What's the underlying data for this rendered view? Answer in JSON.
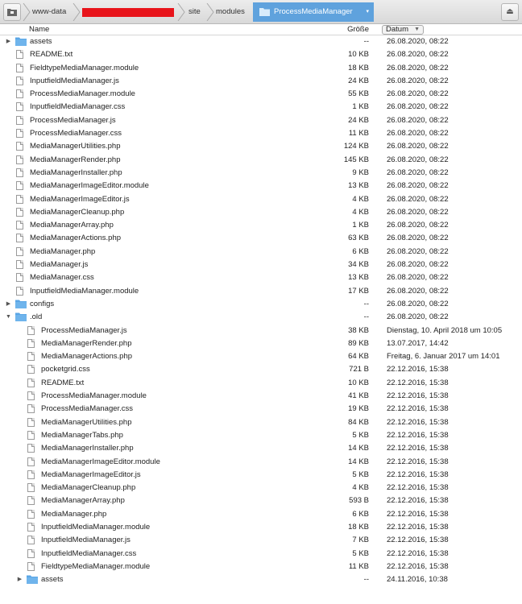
{
  "pathbar": {
    "crumbs": [
      "www-data",
      "site",
      "modules"
    ],
    "active": "ProcessMediaManager"
  },
  "columns": {
    "name": "Name",
    "size": "Größe",
    "date": "Datum"
  },
  "colors": {
    "folder": "#5aa6e6",
    "active_crumb": "#5fa2dd",
    "redaction": "#e8141b"
  },
  "rows": [
    {
      "name": "assets",
      "size": "--",
      "date": "26.08.2020, 08:22",
      "type": "folder",
      "level": 0,
      "disclosure": "collapsed"
    },
    {
      "name": "README.txt",
      "size": "10 KB",
      "date": "26.08.2020, 08:22",
      "type": "file",
      "level": 0
    },
    {
      "name": "FieldtypeMediaManager.module",
      "size": "18 KB",
      "date": "26.08.2020, 08:22",
      "type": "file",
      "level": 0
    },
    {
      "name": "InputfieldMediaManager.js",
      "size": "24 KB",
      "date": "26.08.2020, 08:22",
      "type": "file",
      "level": 0
    },
    {
      "name": "ProcessMediaManager.module",
      "size": "55 KB",
      "date": "26.08.2020, 08:22",
      "type": "file",
      "level": 0
    },
    {
      "name": "InputfieldMediaManager.css",
      "size": "1 KB",
      "date": "26.08.2020, 08:22",
      "type": "file",
      "level": 0
    },
    {
      "name": "ProcessMediaManager.js",
      "size": "24 KB",
      "date": "26.08.2020, 08:22",
      "type": "file",
      "level": 0
    },
    {
      "name": "ProcessMediaManager.css",
      "size": "11 KB",
      "date": "26.08.2020, 08:22",
      "type": "file",
      "level": 0
    },
    {
      "name": "MediaManagerUtilities.php",
      "size": "124 KB",
      "date": "26.08.2020, 08:22",
      "type": "file",
      "level": 0
    },
    {
      "name": "MediaManagerRender.php",
      "size": "145 KB",
      "date": "26.08.2020, 08:22",
      "type": "file",
      "level": 0
    },
    {
      "name": "MediaManagerInstaller.php",
      "size": "9 KB",
      "date": "26.08.2020, 08:22",
      "type": "file",
      "level": 0
    },
    {
      "name": "MediaManagerImageEditor.module",
      "size": "13 KB",
      "date": "26.08.2020, 08:22",
      "type": "file",
      "level": 0
    },
    {
      "name": "MediaManagerImageEditor.js",
      "size": "4 KB",
      "date": "26.08.2020, 08:22",
      "type": "file",
      "level": 0
    },
    {
      "name": "MediaManagerCleanup.php",
      "size": "4 KB",
      "date": "26.08.2020, 08:22",
      "type": "file",
      "level": 0
    },
    {
      "name": "MediaManagerArray.php",
      "size": "1 KB",
      "date": "26.08.2020, 08:22",
      "type": "file",
      "level": 0
    },
    {
      "name": "MediaManagerActions.php",
      "size": "63 KB",
      "date": "26.08.2020, 08:22",
      "type": "file",
      "level": 0
    },
    {
      "name": "MediaManager.php",
      "size": "6 KB",
      "date": "26.08.2020, 08:22",
      "type": "file",
      "level": 0
    },
    {
      "name": "MediaManager.js",
      "size": "34 KB",
      "date": "26.08.2020, 08:22",
      "type": "file",
      "level": 0
    },
    {
      "name": "MediaManager.css",
      "size": "13 KB",
      "date": "26.08.2020, 08:22",
      "type": "file",
      "level": 0
    },
    {
      "name": "InputfieldMediaManager.module",
      "size": "17 KB",
      "date": "26.08.2020, 08:22",
      "type": "file",
      "level": 0
    },
    {
      "name": "configs",
      "size": "--",
      "date": "26.08.2020, 08:22",
      "type": "folder",
      "level": 0,
      "disclosure": "collapsed"
    },
    {
      "name": ".old",
      "size": "--",
      "date": "26.08.2020, 08:22",
      "type": "folder",
      "level": 0,
      "disclosure": "expanded"
    },
    {
      "name": "ProcessMediaManager.js",
      "size": "38 KB",
      "date": "Dienstag, 10. April 2018 um 10:05",
      "type": "file",
      "level": 1
    },
    {
      "name": "MediaManagerRender.php",
      "size": "89 KB",
      "date": "13.07.2017, 14:42",
      "type": "file",
      "level": 1
    },
    {
      "name": "MediaManagerActions.php",
      "size": "64 KB",
      "date": "Freitag, 6. Januar 2017 um 14:01",
      "type": "file",
      "level": 1
    },
    {
      "name": "pocketgrid.css",
      "size": "721 B",
      "date": "22.12.2016, 15:38",
      "type": "file",
      "level": 1
    },
    {
      "name": "README.txt",
      "size": "10 KB",
      "date": "22.12.2016, 15:38",
      "type": "file",
      "level": 1
    },
    {
      "name": "ProcessMediaManager.module",
      "size": "41 KB",
      "date": "22.12.2016, 15:38",
      "type": "file",
      "level": 1
    },
    {
      "name": "ProcessMediaManager.css",
      "size": "19 KB",
      "date": "22.12.2016, 15:38",
      "type": "file",
      "level": 1
    },
    {
      "name": "MediaManagerUtilities.php",
      "size": "84 KB",
      "date": "22.12.2016, 15:38",
      "type": "file",
      "level": 1
    },
    {
      "name": "MediaManagerTabs.php",
      "size": "5 KB",
      "date": "22.12.2016, 15:38",
      "type": "file",
      "level": 1
    },
    {
      "name": "MediaManagerInstaller.php",
      "size": "14 KB",
      "date": "22.12.2016, 15:38",
      "type": "file",
      "level": 1
    },
    {
      "name": "MediaManagerImageEditor.module",
      "size": "14 KB",
      "date": "22.12.2016, 15:38",
      "type": "file",
      "level": 1
    },
    {
      "name": "MediaManagerImageEditor.js",
      "size": "5 KB",
      "date": "22.12.2016, 15:38",
      "type": "file",
      "level": 1
    },
    {
      "name": "MediaManagerCleanup.php",
      "size": "4 KB",
      "date": "22.12.2016, 15:38",
      "type": "file",
      "level": 1
    },
    {
      "name": "MediaManagerArray.php",
      "size": "593 B",
      "date": "22.12.2016, 15:38",
      "type": "file",
      "level": 1
    },
    {
      "name": "MediaManager.php",
      "size": "6 KB",
      "date": "22.12.2016, 15:38",
      "type": "file",
      "level": 1
    },
    {
      "name": "InputfieldMediaManager.module",
      "size": "18 KB",
      "date": "22.12.2016, 15:38",
      "type": "file",
      "level": 1
    },
    {
      "name": "InputfieldMediaManager.js",
      "size": "7 KB",
      "date": "22.12.2016, 15:38",
      "type": "file",
      "level": 1
    },
    {
      "name": "InputfieldMediaManager.css",
      "size": "5 KB",
      "date": "22.12.2016, 15:38",
      "type": "file",
      "level": 1
    },
    {
      "name": "FieldtypeMediaManager.module",
      "size": "11 KB",
      "date": "22.12.2016, 15:38",
      "type": "file",
      "level": 1
    },
    {
      "name": "assets",
      "size": "--",
      "date": "24.11.2016, 10:38",
      "type": "folder",
      "level": 1,
      "disclosure": "collapsed"
    }
  ]
}
